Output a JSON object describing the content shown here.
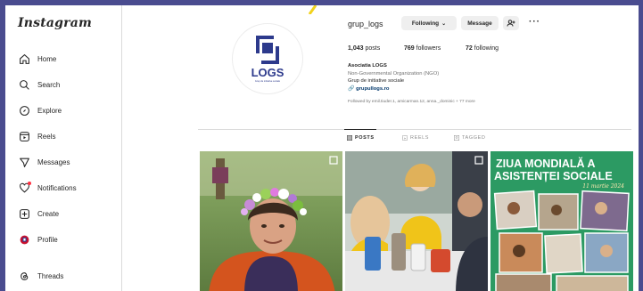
{
  "sidebar": {
    "logo": "Instagram",
    "items": [
      {
        "label": "Home",
        "icon": "home-icon"
      },
      {
        "label": "Search",
        "icon": "search-icon"
      },
      {
        "label": "Explore",
        "icon": "compass-icon"
      },
      {
        "label": "Reels",
        "icon": "reels-icon"
      },
      {
        "label": "Messages",
        "icon": "messenger-icon"
      },
      {
        "label": "Notifications",
        "icon": "heart-icon"
      },
      {
        "label": "Create",
        "icon": "plus-square-icon"
      },
      {
        "label": "Profile",
        "icon": "profile-avatar-icon"
      },
      {
        "label": "Threads",
        "icon": "threads-icon"
      }
    ]
  },
  "profile": {
    "username": "grup_logs",
    "following_button": "Following",
    "message_button": "Message",
    "avatar_text": "LOGS",
    "avatar_subtext": "Grup de initiative sociale",
    "stats": {
      "posts_count": "1,043",
      "posts_label": "posts",
      "followers_count": "769",
      "followers_label": "followers",
      "following_count": "72",
      "following_label": "following"
    },
    "bio": {
      "name": "Asociatia LOGS",
      "category": "Non-Governmental Organization (NGO)",
      "description": "Grup de initiative sociale",
      "link": "grupullogs.ro",
      "followed_by": "Followed by emil.tiuder.1, amicarman.12, anna._dominic + 77 more"
    }
  },
  "tabs": [
    {
      "label": "POSTS",
      "icon": "grid-icon",
      "active": true
    },
    {
      "label": "REELS",
      "icon": "reels-icon",
      "active": false
    },
    {
      "label": "TAGGED",
      "icon": "tag-icon",
      "active": false
    }
  ],
  "posts": {
    "post3_title_line1": "ZIUA MONDIALĂ A",
    "post3_title_line2": "ASISTENȚEI SOCIALE",
    "post3_date": "11 martie 2024"
  },
  "colors": {
    "background": "#4a4c8f",
    "accent_blue": "#2d3a8c",
    "post3_green": "#2c9a63"
  }
}
